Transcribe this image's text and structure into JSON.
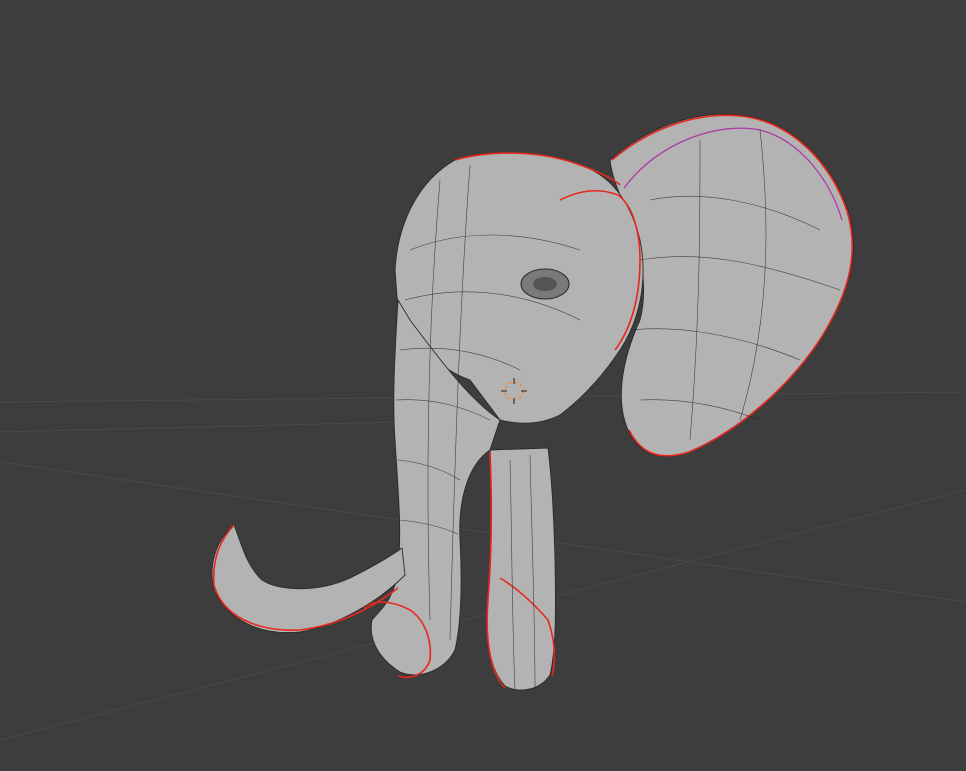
{
  "viewport": {
    "background": "#3d3d3d",
    "grid_color": "#4a4a4a",
    "mesh_color": "#b3b3b3",
    "wire_color": "#2a2a2a",
    "seam_color": "#e8271d",
    "selected_edge_color": "#b03aa8",
    "cursor_color": "#f08a3c"
  },
  "scene": {
    "object_icon": "elephant-head-mesh",
    "cursor_icon": "3d-cursor-icon"
  }
}
